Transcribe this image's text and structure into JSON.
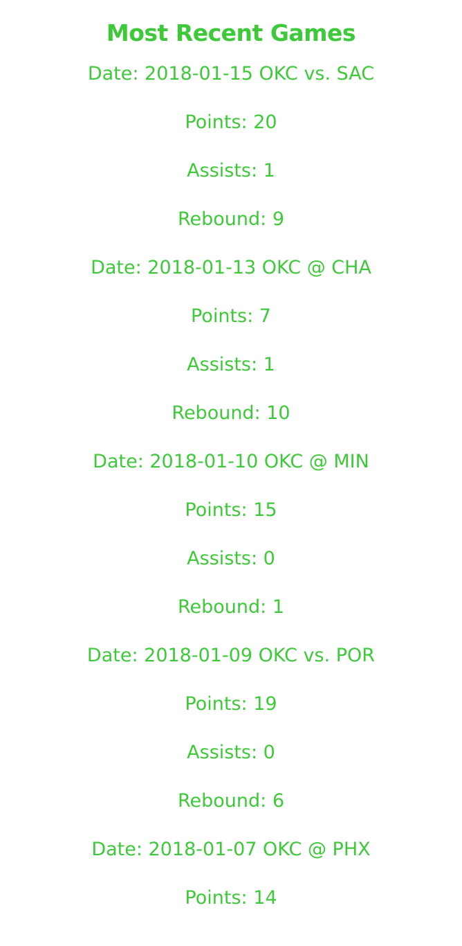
{
  "title": "Most Recent Games",
  "games": [
    {
      "date_line": "Date: 2018-01-15 OKC vs. SAC",
      "points_line": "Points: 20",
      "assists_line": "Assists: 1",
      "rebound_line": "Rebound: 9"
    },
    {
      "date_line": "Date: 2018-01-13 OKC @ CHA",
      "points_line": "Points: 7",
      "assists_line": "Assists: 1",
      "rebound_line": "Rebound: 10"
    },
    {
      "date_line": "Date: 2018-01-10 OKC @ MIN",
      "points_line": "Points: 15",
      "assists_line": "Assists: 0",
      "rebound_line": "Rebound: 1"
    },
    {
      "date_line": "Date: 2018-01-09 OKC vs. POR",
      "points_line": "Points: 19",
      "assists_line": "Assists: 0",
      "rebound_line": "Rebound: 6"
    },
    {
      "date_line": "Date: 2018-01-07 OKC @ PHX",
      "points_line": "Points: 14"
    }
  ],
  "colors": {
    "text": "#3ec93a",
    "background": "#ffffff"
  }
}
